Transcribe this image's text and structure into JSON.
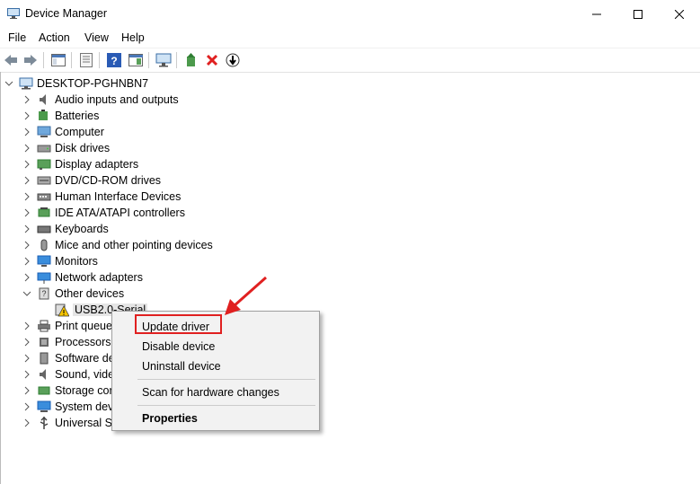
{
  "window": {
    "title": "Device Manager"
  },
  "menu": [
    "File",
    "Action",
    "View",
    "Help"
  ],
  "toolbar_icons": [
    "back-arrow-icon",
    "forward-arrow-icon",
    "show-hide-console-tree-icon",
    "properties-icon",
    "help-icon",
    "show-panel-icon",
    "scan-hardware-icon",
    "update-driver-icon",
    "uninstall-icon",
    "disable-icon"
  ],
  "tree": {
    "root": "DESKTOP-PGHNBN7",
    "items": [
      {
        "label": "Audio inputs and outputs",
        "icon": "speaker-icon"
      },
      {
        "label": "Batteries",
        "icon": "battery-icon"
      },
      {
        "label": "Computer",
        "icon": "computer-icon"
      },
      {
        "label": "Disk drives",
        "icon": "disk-icon"
      },
      {
        "label": "Display adapters",
        "icon": "display-adapter-icon"
      },
      {
        "label": "DVD/CD-ROM drives",
        "icon": "dvd-icon"
      },
      {
        "label": "Human Interface Devices",
        "icon": "hid-icon"
      },
      {
        "label": "IDE ATA/ATAPI controllers",
        "icon": "ide-icon"
      },
      {
        "label": "Keyboards",
        "icon": "keyboard-icon"
      },
      {
        "label": "Mice and other pointing devices",
        "icon": "mouse-icon"
      },
      {
        "label": "Monitors",
        "icon": "monitor-icon"
      },
      {
        "label": "Network adapters",
        "icon": "network-icon"
      },
      {
        "label": "Other devices",
        "icon": "other-devices-icon"
      },
      {
        "label": "USB2.0-Serial",
        "icon": "warning-device-icon"
      },
      {
        "label": "Print queue",
        "icon": "printer-icon"
      },
      {
        "label": "Processors",
        "icon": "processor-icon"
      },
      {
        "label": "Software de",
        "icon": "software-icon"
      },
      {
        "label": "Sound, vide",
        "icon": "sound-icon"
      },
      {
        "label": "Storage cor",
        "icon": "storage-icon"
      },
      {
        "label": "System dev",
        "icon": "system-icon"
      },
      {
        "label": "Universal Se",
        "icon": "usb-icon"
      }
    ]
  },
  "context_menu": {
    "items": [
      "Update driver",
      "Disable device",
      "Uninstall device",
      "Scan for hardware changes",
      "Properties"
    ]
  },
  "colors": {
    "highlight": "#e02020",
    "accent": "#1a5fb4"
  }
}
